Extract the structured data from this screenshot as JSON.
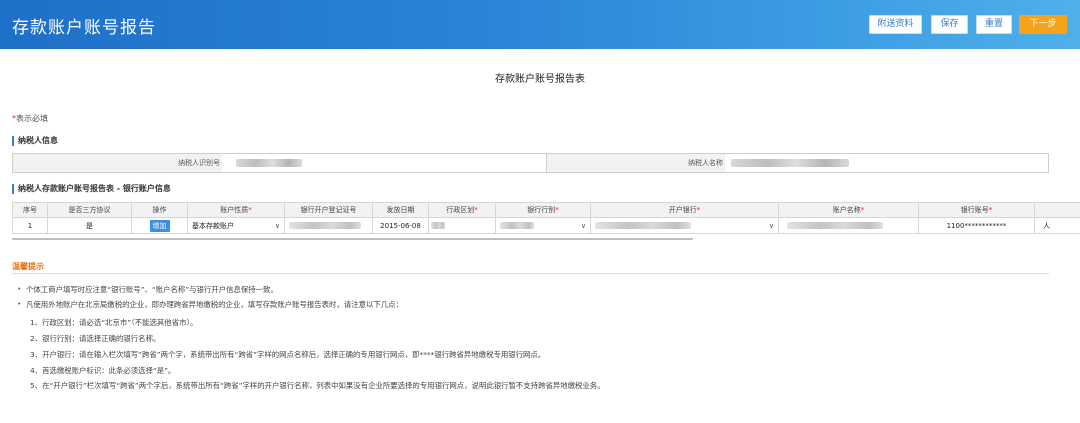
{
  "header": {
    "title": "存款账户账号报告",
    "attach_label": "附送资料",
    "save_label": "保存",
    "reset_label": "重置",
    "next_label": "下一步"
  },
  "page_title": "存款账户账号报告表",
  "required_note": {
    "star": "*",
    "text": "表示必填"
  },
  "taxpayer_section": {
    "title": "纳税人信息",
    "id_label": "纳税人识别号",
    "name_label": "纳税人名称"
  },
  "bank_section": {
    "title": "纳税人存款账户账号报告表 - 银行账户信息",
    "headers": [
      {
        "label": "序号",
        "req": ""
      },
      {
        "label": "是否三方协议",
        "req": ""
      },
      {
        "label": "操作",
        "req": ""
      },
      {
        "label": "账户性质",
        "req": "*"
      },
      {
        "label": "银行开户登记证号",
        "req": ""
      },
      {
        "label": "发放日期",
        "req": ""
      },
      {
        "label": "行政区划",
        "req": "*"
      },
      {
        "label": "银行行别",
        "req": "*"
      },
      {
        "label": "开户银行",
        "req": "*"
      },
      {
        "label": "账户名称",
        "req": "*"
      },
      {
        "label": "银行账号",
        "req": "*"
      },
      {
        "label": "",
        "req": ""
      }
    ],
    "row": {
      "index": "1",
      "tripartite": "是",
      "action": "增加",
      "account_type": "基本存款账户",
      "issue_date": "2015-06-08",
      "account_number": "1100************",
      "extra": "人"
    }
  },
  "tips": {
    "title": "温馨提示",
    "items": [
      "个体工商户填写时应注意“银行账号”、“账户名称”与银行开户信息保持一致。",
      "凡使用外地账户在北京局缴税的企业，即办理跨省异地缴税的企业，填写存款账户账号报告表时，请注意以下几点："
    ],
    "sub_items": [
      "1、行政区划：请必选“北京市”（不能选其他省市）。",
      "2、银行行别：请选择正确的银行名称。",
      "3、开户银行：请在输入栏次填写“跨省”两个字，系统带出所有“跨省”字样的网点名称后，选择正确的专用银行网点，即****银行跨省异地缴税专用银行网点。",
      "4、首选缴税账户标识：此条必须选择“是”。",
      "5、在“开户银行”栏次填写“跨省”两个字后，系统带出所有“跨省”字样的开户银行名称，列表中如果没有企业所要选择的专用银行网点，说明此银行暂不支持跨省异地缴税业务。"
    ]
  },
  "colors": {
    "header_blue": "#2b84d8",
    "next_orange": "#f7a21b",
    "tips_orange": "#e6720f",
    "required_red": "#e2231a"
  }
}
